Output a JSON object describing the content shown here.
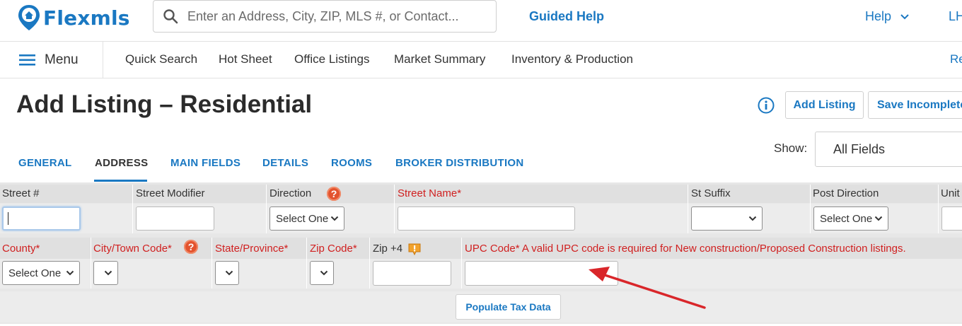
{
  "header": {
    "logo_text": "Flexmls",
    "search_placeholder": "Enter an Address, City, ZIP, MLS #, or Contact...",
    "guided_help": "Guided Help",
    "help": "Help",
    "user_initials": "LH"
  },
  "nav": {
    "menu": "Menu",
    "items": [
      "Quick Search",
      "Hot Sheet",
      "Office Listings",
      "Market Summary",
      "Inventory & Production"
    ],
    "right_partial": "Re"
  },
  "page": {
    "title": "Add Listing – Residential",
    "add_listing": "Add Listing",
    "save_incomplete": "Save Incomplete",
    "show_label": "Show:",
    "show_value": "All Fields"
  },
  "tabs": [
    "GENERAL",
    "ADDRESS",
    "MAIN FIELDS",
    "DETAILS",
    "ROOMS",
    "BROKER DISTRIBUTION"
  ],
  "active_tab": "ADDRESS",
  "row1": {
    "street_num": "Street #",
    "street_modifier": "Street Modifier",
    "direction": "Direction",
    "street_name": "Street Name*",
    "st_suffix": "St Suffix",
    "post_direction": "Post Direction",
    "unit": "Unit",
    "select_one": "Select One"
  },
  "row2": {
    "county": "County*",
    "city": "City/Town Code*",
    "state": "State/Province*",
    "zip": "Zip Code*",
    "zip4": "Zip +4",
    "upc": "UPC Code*  A valid UPC code is required for New construction/Proposed Construction listings.",
    "select_one": "Select One"
  },
  "populate_button": "Populate Tax Data",
  "colors": {
    "brand": "#1a78c2",
    "required": "#d02020",
    "annotation_arrow": "#d9262a"
  }
}
